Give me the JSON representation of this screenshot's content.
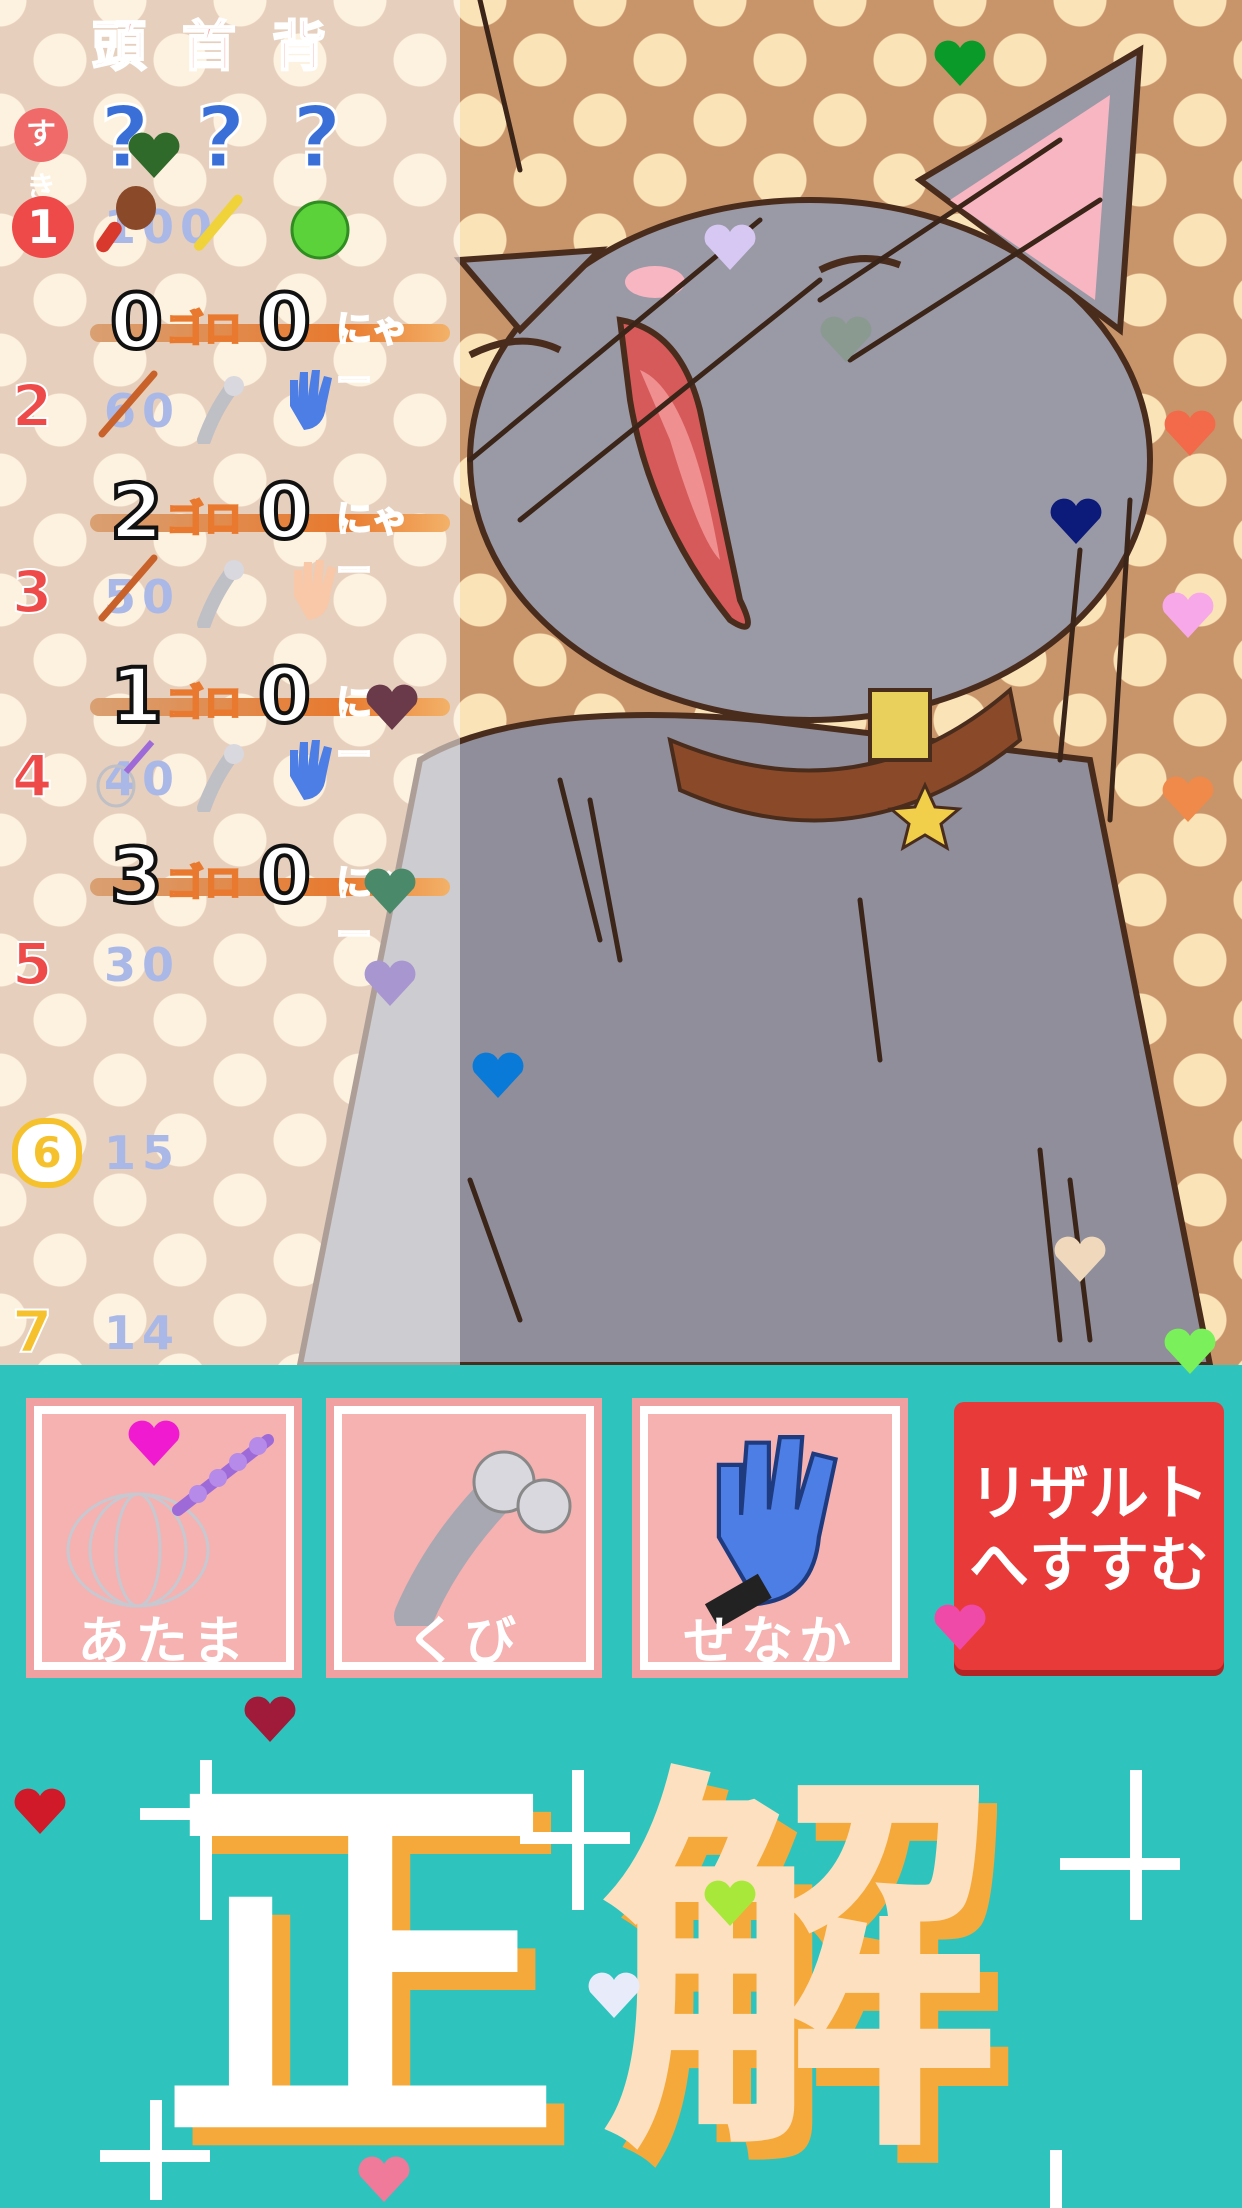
{
  "panel": {
    "header_head": "頭",
    "header_neck": "首",
    "header_back": "背",
    "suki_label": "すき",
    "unknown_marks": [
      "?",
      "?",
      "?"
    ]
  },
  "rounds": [
    {
      "label": "1",
      "score": "100",
      "tools": [
        "brush-icon",
        "toothbrush-icon",
        "green-ball-icon"
      ]
    },
    {
      "label": "2",
      "score": "60",
      "tools": [
        "stick-icon",
        "roller-icon",
        "glove-icon"
      ]
    },
    {
      "label": "3",
      "score": "50",
      "tools": [
        "stick-icon",
        "roller-icon",
        "hand-icon"
      ]
    },
    {
      "label": "4",
      "score": "40",
      "tools": [
        "whisk-icon",
        "roller-icon",
        "glove-icon"
      ]
    },
    {
      "label": "5",
      "score": "30"
    },
    {
      "label": "6",
      "score": "15"
    },
    {
      "label": "7",
      "score": "14"
    }
  ],
  "results": [
    {
      "goro_count": "0",
      "goro_label": "ゴロ",
      "nya_count": "0",
      "nya_label": "にゃー"
    },
    {
      "goro_count": "2",
      "goro_label": "ゴロ",
      "nya_count": "0",
      "nya_label": "にゃー"
    },
    {
      "goro_count": "1",
      "goro_label": "ゴロ",
      "nya_count": "0",
      "nya_label": "にゃー"
    },
    {
      "goro_count": "3",
      "goro_label": "ゴロ",
      "nya_count": "0",
      "nya_label": "にゃー"
    }
  ],
  "buttons": {
    "head": {
      "label": "あたま",
      "tool": "scalp-massager-icon"
    },
    "neck": {
      "label": "くび",
      "tool": "face-roller-icon"
    },
    "back": {
      "label": "せなか",
      "tool": "grooming-glove-icon"
    },
    "result_line1": "リザルト",
    "result_line2": "へすすむ"
  },
  "verdict": {
    "char1": "正",
    "char2": "解"
  },
  "colors": {
    "teal": "#2ec4bd",
    "result_red": "#e93a3a",
    "button_pink": "#f6b1b1",
    "verdict_orange": "#f5a93a",
    "cat_gray": "#8f8e9a"
  }
}
